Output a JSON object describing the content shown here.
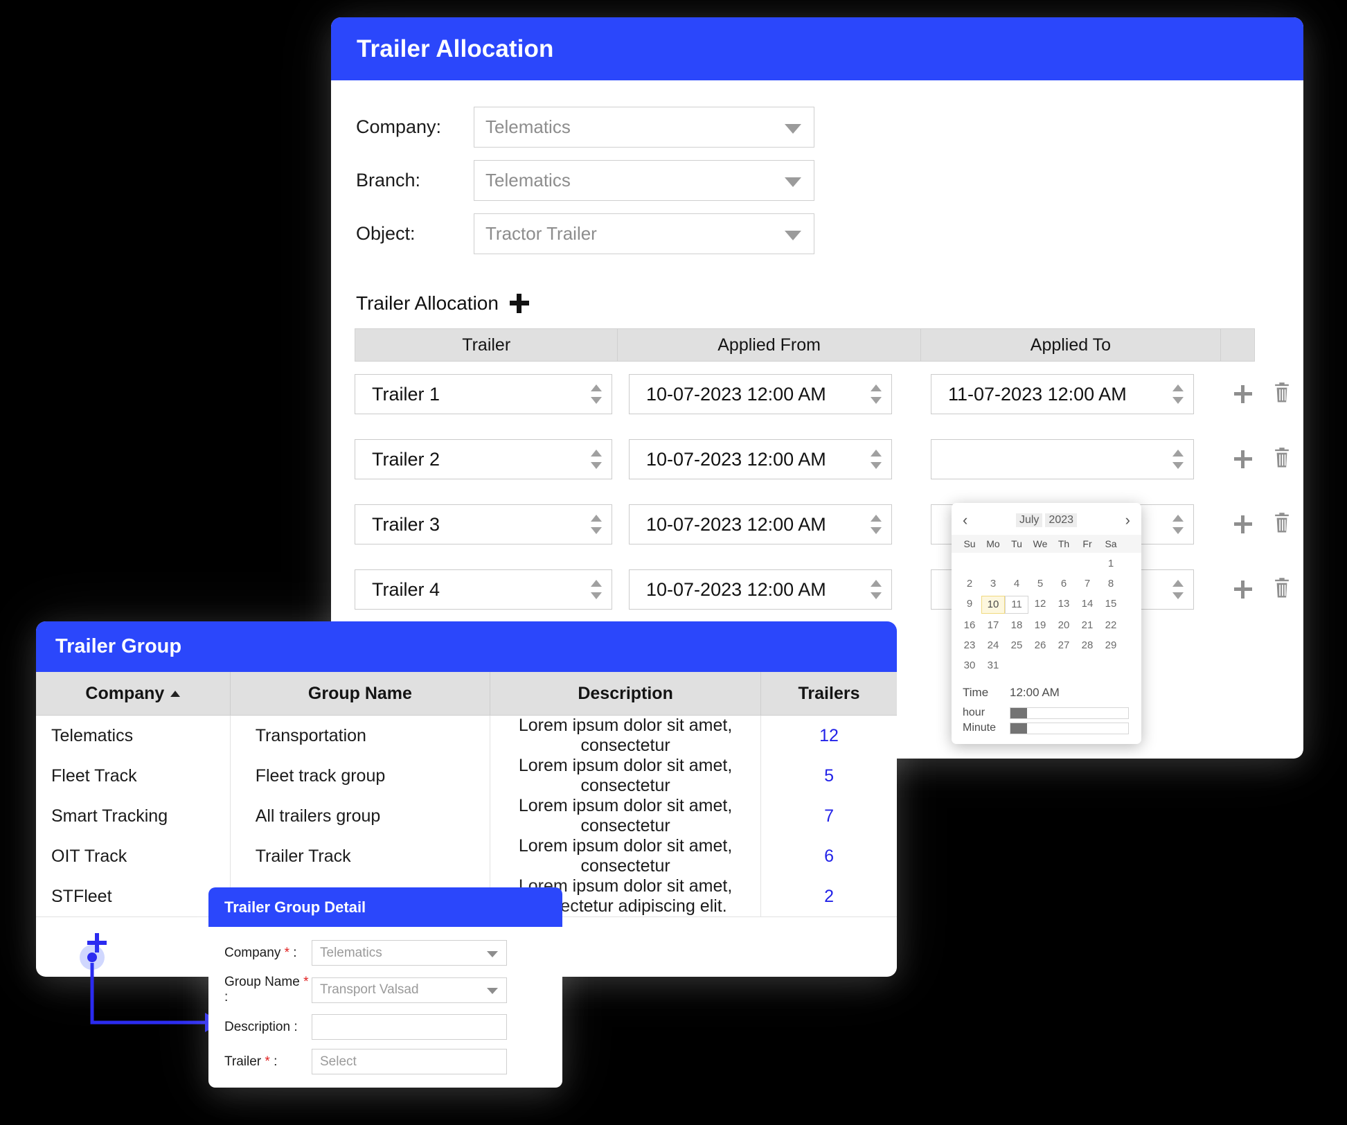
{
  "theme": {
    "accent_blue": "#2b47fb",
    "link_blue": "#2222e8",
    "header_gray": "#e0e0e0",
    "required_red": "#e02020",
    "page_background": "#000000"
  },
  "trailer_allocation": {
    "title": "Trailer Allocation",
    "filters": [
      {
        "label": "Company:",
        "value": "Telematics"
      },
      {
        "label": "Branch:",
        "value": "Telematics"
      },
      {
        "label": "Object:",
        "value": "Tractor Trailer"
      }
    ],
    "section_title": "Trailer Allocation",
    "add_icon": "plus-icon",
    "columns": [
      "Trailer",
      "Applied From",
      "Applied To",
      ""
    ],
    "rows": [
      {
        "trailer": "Trailer 1",
        "applied_from": "10-07-2023 12:00 AM",
        "applied_to": "11-07-2023 12:00 AM"
      },
      {
        "trailer": "Trailer 2",
        "applied_from": "10-07-2023 12:00 AM",
        "applied_to": ""
      },
      {
        "trailer": "Trailer 3",
        "applied_from": "10-07-2023 12:00 AM",
        "applied_to": ""
      },
      {
        "trailer": "Trailer 4",
        "applied_from": "10-07-2023 12:00 AM",
        "applied_to": ""
      }
    ],
    "row_action_icons": [
      "plus-icon",
      "trash-icon"
    ]
  },
  "date_picker": {
    "prev_label": "‹",
    "next_label": "›",
    "month": "July",
    "year": "2023",
    "day_headers": [
      "Su",
      "Mo",
      "Tu",
      "We",
      "Th",
      "Fr",
      "Sa"
    ],
    "weeks": [
      [
        "",
        "",
        "",
        "",
        "",
        "",
        "1"
      ],
      [
        "2",
        "3",
        "4",
        "5",
        "6",
        "7",
        "8"
      ],
      [
        "9",
        "10",
        "11",
        "12",
        "13",
        "14",
        "15"
      ],
      [
        "16",
        "17",
        "18",
        "19",
        "20",
        "21",
        "22"
      ],
      [
        "23",
        "24",
        "25",
        "26",
        "27",
        "28",
        "29"
      ],
      [
        "30",
        "31",
        "",
        "",
        "",
        "",
        ""
      ]
    ],
    "selected_day": "10",
    "highlighted_day": "11",
    "time_label": "Time",
    "time_value": "12:00 AM",
    "hour_label": "hour",
    "minute_label": "Minute"
  },
  "trailer_group": {
    "title": "Trailer Group",
    "columns": [
      "Company",
      "Group Name",
      "Description",
      "Trailers"
    ],
    "sort_column": "Company",
    "sort_direction": "asc",
    "rows": [
      {
        "company": "Telematics",
        "group_name": "Transportation",
        "description": "Lorem ipsum dolor sit amet, consectetur",
        "trailers": "12"
      },
      {
        "company": "Fleet Track",
        "group_name": "Fleet track group",
        "description": "Lorem ipsum dolor sit amet, consectetur",
        "trailers": "5"
      },
      {
        "company": "Smart Tracking",
        "group_name": "All trailers group",
        "description": "Lorem ipsum dolor sit amet, consectetur",
        "trailers": "7"
      },
      {
        "company": "OIT Track",
        "group_name": "Trailer Track",
        "description": "Lorem ipsum dolor sit amet, consectetur",
        "trailers": "6"
      },
      {
        "company": "STFleet",
        "group_name": "",
        "description": "Lorem ipsum dolor sit amet, consectetur adipiscing elit.",
        "trailers": "2"
      }
    ],
    "add_icon": "plus-icon"
  },
  "trailer_group_detail": {
    "title": "Trailer Group Detail",
    "fields": [
      {
        "label": "Company",
        "required": true,
        "value": "Telematics",
        "control": "dropdown"
      },
      {
        "label": "Group Name",
        "required": true,
        "value": "Transport Valsad",
        "control": "dropdown"
      },
      {
        "label": "Description",
        "required": false,
        "value": "",
        "control": "text"
      },
      {
        "label": "Trailer",
        "required": true,
        "value": "Select",
        "control": "text"
      }
    ],
    "required_marker": "*",
    "label_suffix": ":"
  }
}
